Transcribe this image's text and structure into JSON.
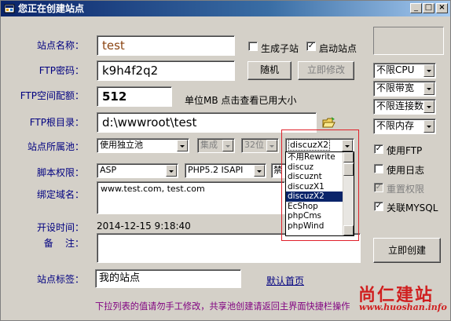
{
  "window": {
    "title": "您正在创建站点",
    "min": "_",
    "max": "□",
    "close": "×"
  },
  "site_name": {
    "label": "站点名称：",
    "value": "test"
  },
  "create_subsite": {
    "label": "生成子站",
    "checked": false
  },
  "start_site": {
    "label": "启动站点",
    "checked": true
  },
  "ftp_password": {
    "label": "FTP密码：",
    "value": "k9h4f2q2",
    "random_button": "随机",
    "apply_button": "立即修改"
  },
  "ftp_quota": {
    "label": "FTP空间配额：",
    "value": "512",
    "hint": "单位MB 点击查看已用大小"
  },
  "ftp_root": {
    "label": "FTP根目录：",
    "value": "d:\\wwwroot\\test"
  },
  "app_pool": {
    "label": "站点所属池：",
    "pool": "使用独立池",
    "mode": "集成",
    "bits": "32位",
    "rewrite": "discuzX2"
  },
  "script": {
    "label": "脚本权限：",
    "lang": "ASP",
    "php": "PHP5.2 ISAPI",
    "extra": "禁"
  },
  "bind_domain": {
    "label": "绑定域名：",
    "value": "www.test.com, test.com"
  },
  "open_time": {
    "label": "开设时间：",
    "value": "2014-12-15 9:18:40"
  },
  "remark": {
    "label": "备    注：",
    "value": ""
  },
  "site_tag": {
    "label": "站点标签：",
    "value": "我的站点",
    "link": "默认首页"
  },
  "dropdown": {
    "items": [
      "不用Rewrite",
      "discuz",
      "discuznt",
      "discuzX1",
      "discuzX2",
      "EcShop",
      "phpCms",
      "phpWind"
    ],
    "selected_index": 4
  },
  "limits": {
    "cpu": "不限CPU",
    "bandwidth": "不限带宽",
    "connections": "不限连接数",
    "memory": "不限内存"
  },
  "options": {
    "use_ftp": {
      "label": "使用FTP",
      "checked": true
    },
    "use_log": {
      "label": "使用日志",
      "checked": false
    },
    "reset_perm": {
      "label": "重置权限",
      "checked": true,
      "disabled": true
    },
    "link_mysql": {
      "label": "关联MYSQL",
      "checked": true
    }
  },
  "create_button": "立即创建",
  "footer_note": "下拉列表的值请勿手工修改，共享池创建请返回主界面快捷栏操作",
  "watermark": {
    "name": "尚仁建站",
    "url": "www.huoshan.info"
  }
}
